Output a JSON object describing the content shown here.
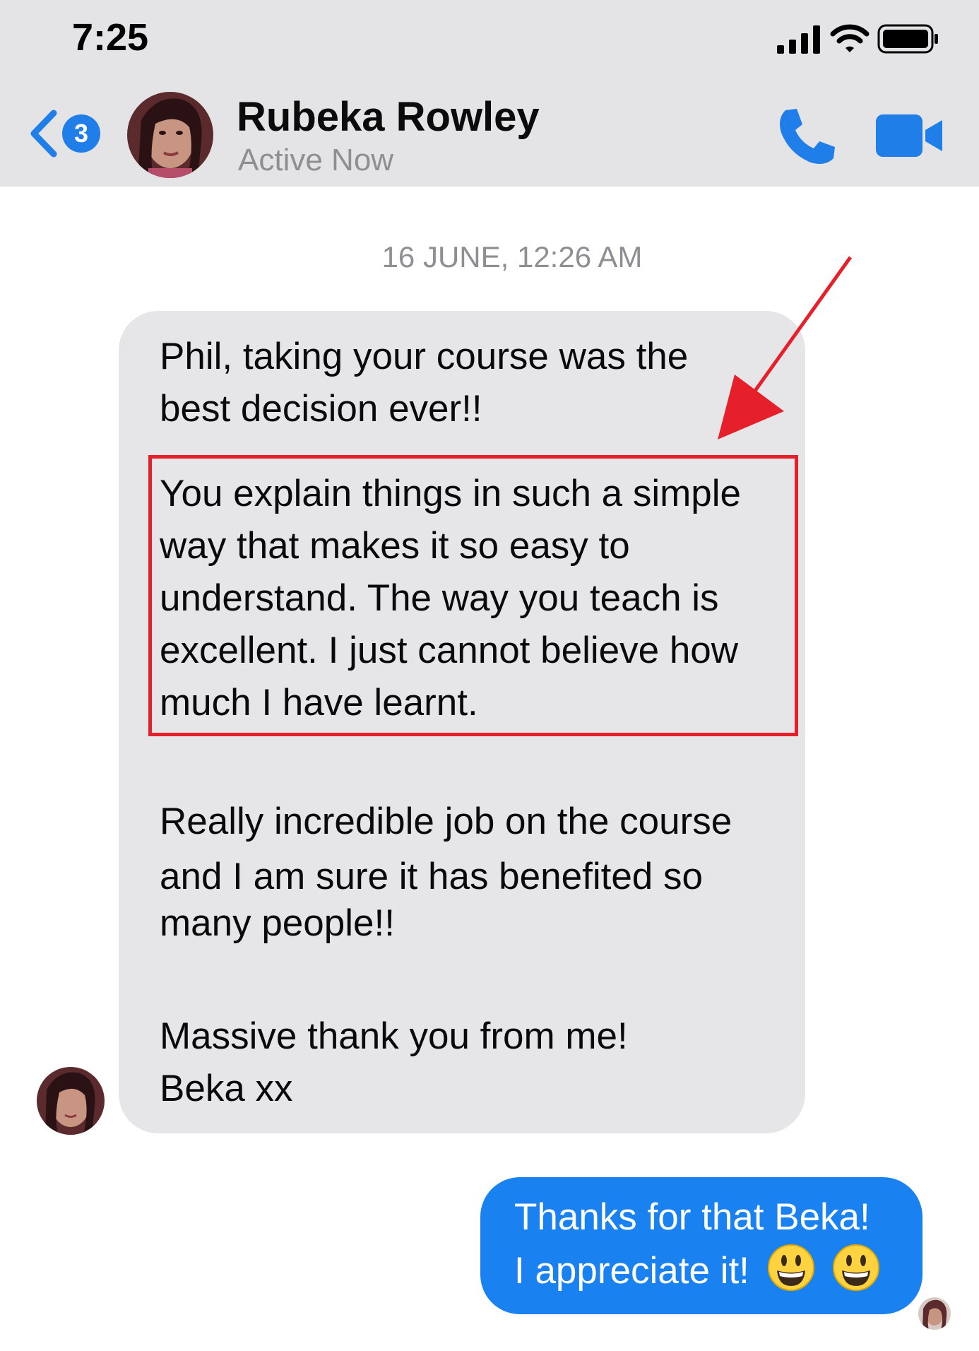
{
  "status_bar": {
    "time": "7:25",
    "icons": [
      "signal-icon",
      "wifi-icon",
      "battery-icon"
    ]
  },
  "nav": {
    "back_badge": "3",
    "contact_name": "Rubeka Rowley",
    "contact_status": "Active Now",
    "icons": [
      "back-chevron-icon",
      "phone-icon",
      "video-camera-icon"
    ],
    "accent_color": "#1f7ee8"
  },
  "conversation": {
    "timestamp": "16 JUNE, 12:26 AM",
    "incoming": {
      "lines": [
        "Phil, taking your course was the",
        "best decision ever!!",
        "You explain things in such a simple",
        "way that makes it so easy to",
        "understand. The way you teach is",
        "excellent. I just cannot believe how",
        "much I have learnt.",
        "Really incredible job on the course",
        "and I am sure it has benefited so",
        "many people!!",
        "Massive thank you from me!",
        "Beka xx"
      ],
      "bubble_color": "#e6e6e8"
    },
    "outgoing": {
      "lines": [
        "Thanks for that Beka!",
        "I appreciate it!"
      ],
      "emojis": [
        "grinning-face-emoji",
        "grinning-face-emoji"
      ],
      "bubble_color": "#1a82f0"
    },
    "annotation": {
      "highlight_color": "#e5202b",
      "arrow_color": "#e5202b"
    }
  }
}
